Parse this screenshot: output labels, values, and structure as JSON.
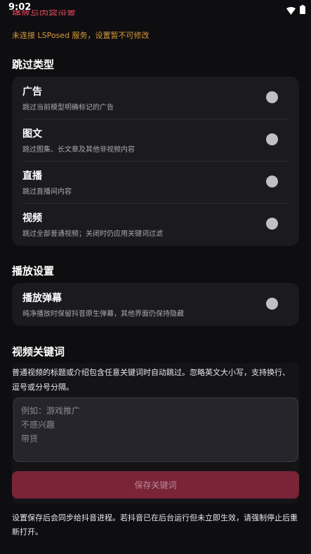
{
  "status_bar": {
    "time": "9:02"
  },
  "header": {
    "cut_title": "播放与内容设置",
    "warning": "未连接 LSPosed 服务，设置暂不可修改"
  },
  "skip_types": {
    "title": "跳过类型",
    "items": [
      {
        "label": "广告",
        "desc": "跳过当前模型明确标记的广告",
        "selected": false
      },
      {
        "label": "图文",
        "desc": "跳过图集、长文章及其他非视频内容",
        "selected": false
      },
      {
        "label": "直播",
        "desc": "跳过直播间内容",
        "selected": false
      },
      {
        "label": "视频",
        "desc": "跳过全部普通视频；关闭时仍应用关键词过滤",
        "selected": false
      }
    ]
  },
  "playback": {
    "title": "播放设置",
    "items": [
      {
        "label": "播放弹幕",
        "desc": "纯净播放时保留抖音原生弹幕，其他界面仍保持隐藏",
        "selected": false
      }
    ]
  },
  "keywords": {
    "title": "视频关键词",
    "desc": "普通视频的标题或介绍包含任意关键词时自动跳过。忽略英文大小写，支持换行、逗号或分号分隔。",
    "placeholder": "例如：游戏推广\n不感兴趣\n带货",
    "save_label": "保存关键词"
  },
  "footer_note": "设置保存后会同步给抖音进程。若抖音已在后台运行但未立即生效，请强制停止后重新打开。",
  "colors": {
    "background": "#0e0e10",
    "card": "#1b1b1f",
    "warning": "#d99a3c",
    "accent_disabled": "#7b2438"
  }
}
